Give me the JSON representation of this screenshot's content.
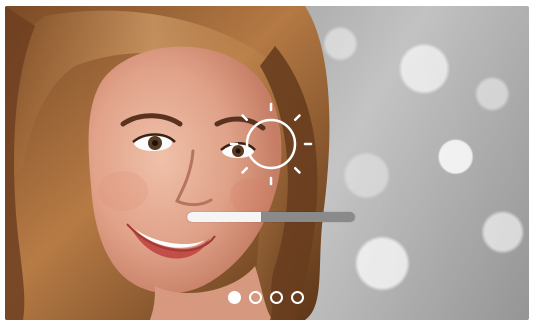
{
  "brightness_overlay": {
    "icon": "sun-icon",
    "level_fraction": 0.44
  },
  "pagination": {
    "count": 4,
    "active_index": 0
  },
  "colors": {
    "overlay_white": "#ffffff",
    "slider_track": "#8a8a8a",
    "slider_fill": "#f5f5f5"
  }
}
